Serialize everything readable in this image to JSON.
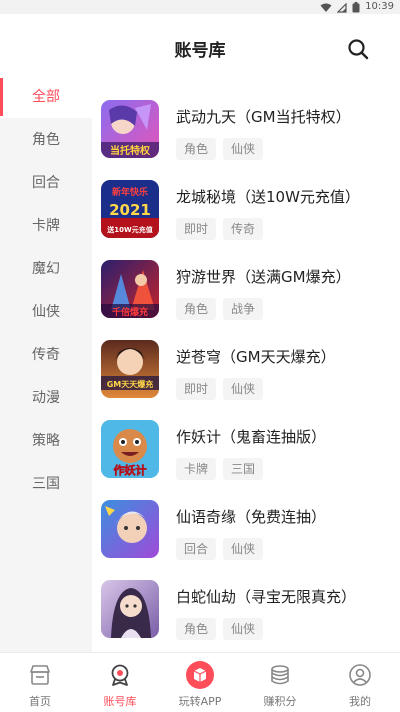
{
  "statusbar": {
    "time": "10:39",
    "icons": [
      "wifi-icon",
      "signal-icon",
      "battery-icon"
    ]
  },
  "header": {
    "title": "账号库",
    "search_icon": "search-icon"
  },
  "sidebar": {
    "items": [
      {
        "label": "全部",
        "active": true
      },
      {
        "label": "角色"
      },
      {
        "label": "回合"
      },
      {
        "label": "卡牌"
      },
      {
        "label": "魔幻"
      },
      {
        "label": "仙侠"
      },
      {
        "label": "传奇"
      },
      {
        "label": "动漫"
      },
      {
        "label": "策略"
      },
      {
        "label": "三国"
      }
    ]
  },
  "games": [
    {
      "name": "武动九天（GM当托特权）",
      "tags": [
        "角色",
        "仙侠"
      ],
      "thumb_text": "当托特权"
    },
    {
      "name": "龙城秘境（送10W元充值）",
      "tags": [
        "即时",
        "传奇"
      ],
      "thumb_text": [
        "新年快乐",
        "2021",
        "送10W元充值"
      ]
    },
    {
      "name": "狩游世界（送满GM爆充）",
      "tags": [
        "角色",
        "战争"
      ],
      "thumb_text": "千倍爆充"
    },
    {
      "name": "逆苍穹（GM天天爆充）",
      "tags": [
        "即时",
        "仙侠"
      ],
      "thumb_text": "GM天天爆充"
    },
    {
      "name": "作妖计（鬼畜连抽版）",
      "tags": [
        "卡牌",
        "三国"
      ],
      "thumb_text": "作妖计"
    },
    {
      "name": "仙语奇缘（免费连抽）",
      "tags": [
        "回合",
        "仙侠"
      ],
      "thumb_text": ""
    },
    {
      "name": "白蛇仙劫（寻宝无限真充）",
      "tags": [
        "角色",
        "仙侠"
      ],
      "thumb_text": ""
    }
  ],
  "bottomnav": {
    "items": [
      {
        "label": "首页",
        "icon": "store-icon"
      },
      {
        "label": "账号库",
        "icon": "account-library-icon",
        "active": true
      },
      {
        "label": "玩转APP",
        "icon": "app-icon"
      },
      {
        "label": "赚积分",
        "icon": "coins-icon"
      },
      {
        "label": "我的",
        "icon": "profile-icon"
      }
    ]
  },
  "colors": {
    "accent": "#ff4d5a",
    "sidebar_bg": "#f5f5f5",
    "tag_bg": "#f4f4f4",
    "text_primary": "#222222",
    "text_secondary": "#888888"
  }
}
